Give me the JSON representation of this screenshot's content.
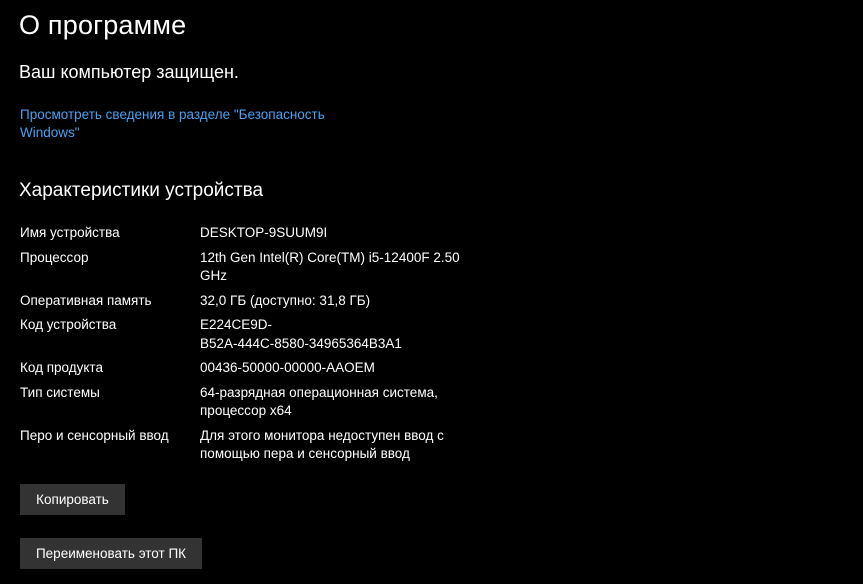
{
  "page": {
    "title": "О программе"
  },
  "security": {
    "status": "Ваш компьютер защищен.",
    "link_text": "Просмотреть сведения в разделе \"Безопасность Windows\""
  },
  "device_specs": {
    "heading": "Характеристики устройства",
    "rows": [
      {
        "label": "Имя устройства",
        "value": "DESKTOP-9SUUM9I"
      },
      {
        "label": "Процессор",
        "value": "12th Gen Intel(R) Core(TM) i5-12400F   2.50\nGHz"
      },
      {
        "label": "Оперативная память",
        "value": "32,0 ГБ (доступно: 31,8 ГБ)"
      },
      {
        "label": "Код устройства",
        "value": "E224CE9D-\nB52A-444C-8580-34965364B3A1"
      },
      {
        "label": "Код продукта",
        "value": "00436-50000-00000-AAOEM"
      },
      {
        "label": "Тип системы",
        "value": "64-разрядная операционная система,\nпроцессор x64"
      },
      {
        "label": "Перо и сенсорный ввод",
        "value": "Для этого монитора недоступен ввод с\nпомощью пера и сенсорный ввод"
      }
    ]
  },
  "buttons": {
    "copy_label": "Копировать",
    "rename_label": "Переименовать этот ПК"
  },
  "colors": {
    "background": "#000000",
    "text": "#ffffff",
    "link": "#4ca0f0",
    "button_bg": "#333333"
  }
}
